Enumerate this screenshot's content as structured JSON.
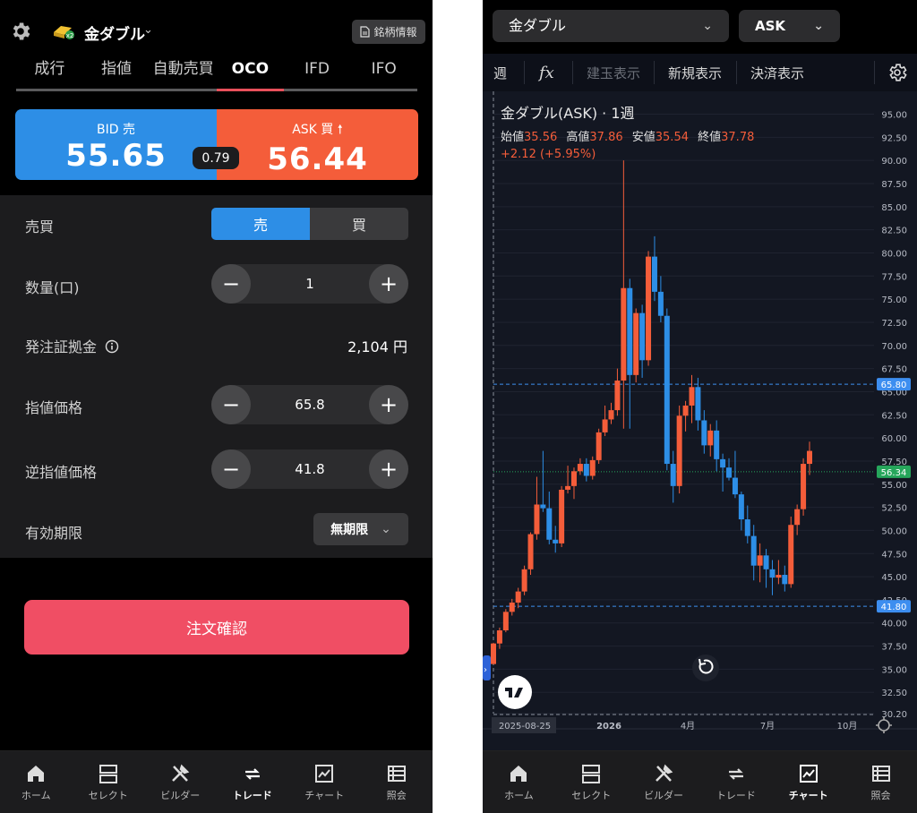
{
  "left": {
    "header": {
      "symbol": "金ダブル",
      "info_button": "銘柄情報"
    },
    "tabs": [
      "成行",
      "指値",
      "自動売買",
      "OCO",
      "IFD",
      "IFO"
    ],
    "active_tab": "OCO",
    "quote": {
      "bid_label": "BID 売",
      "bid": "55.65",
      "ask_label": "ASK 買",
      "ask": "56.44",
      "spread": "0.79"
    },
    "form": {
      "side_label": "売買",
      "sell": "売",
      "buy": "買",
      "qty_label": "数量(口)",
      "qty": "1",
      "margin_label": "発注証拠金",
      "margin": "2,104 円",
      "limit_label": "指値価格",
      "limit": "65.8",
      "stop_label": "逆指値価格",
      "stop": "41.8",
      "expiry_label": "有効期限",
      "expiry": "無期限"
    },
    "confirm": "注文確認",
    "nav": [
      "ホーム",
      "セレクト",
      "ビルダー",
      "トレード",
      "チャート",
      "照会"
    ],
    "nav_active": "トレード"
  },
  "right": {
    "symbol_select": "金ダブル",
    "side_select": "ASK",
    "toolbar": {
      "interval": "週",
      "fx": "fx",
      "pos": "建玉表示",
      "new": "新規表示",
      "settle": "決済表示"
    },
    "legend": {
      "title": "金ダブル(ASK) · 1週",
      "open_label": "始値",
      "open": "35.56",
      "high_label": "高値",
      "high": "37.86",
      "low_label": "安値",
      "low": "35.54",
      "close_label": "終値",
      "close": "37.78",
      "change": "+2.12 (+5.95%)"
    },
    "nav": [
      "ホーム",
      "セレクト",
      "ビルダー",
      "トレード",
      "チャート",
      "照会"
    ],
    "nav_active": "チャート",
    "colors": {
      "up": "#f45d3a",
      "down": "#2d8ee6",
      "line": "#3d8ef0"
    }
  },
  "chart_data": {
    "type": "candlestick",
    "y_ticks": [
      "95.00",
      "92.50",
      "90.00",
      "87.50",
      "85.00",
      "82.50",
      "80.00",
      "77.50",
      "75.00",
      "72.50",
      "70.00",
      "67.50",
      "65.00",
      "62.50",
      "60.00",
      "57.50",
      "55.00",
      "52.50",
      "50.00",
      "47.50",
      "45.00",
      "42.50",
      "40.00",
      "37.50",
      "35.00",
      "32.50",
      "30.20"
    ],
    "ylim": [
      30.2,
      96.5
    ],
    "x_labels": [
      "2025-08-25",
      "2026",
      "4月",
      "7月",
      "10月"
    ],
    "price_lines": [
      {
        "value": 65.8,
        "label": "65.80"
      },
      {
        "value": 41.8,
        "label": "41.80"
      }
    ],
    "last_price": {
      "value": 56.34,
      "label": "56.34"
    },
    "candles": [
      [
        35.56,
        37.86,
        35.54,
        37.78
      ],
      [
        37.78,
        39.5,
        37.2,
        39.2
      ],
      [
        39.2,
        41.5,
        39,
        41.2
      ],
      [
        41.2,
        42.6,
        40.8,
        42.2
      ],
      [
        42.2,
        43.8,
        41.6,
        43.4
      ],
      [
        43.4,
        46.2,
        43,
        45.8
      ],
      [
        45.8,
        49.8,
        45.2,
        49.6
      ],
      [
        49.6,
        55.8,
        49,
        52.8
      ],
      [
        52.8,
        58.6,
        52,
        52.4
      ],
      [
        52.4,
        54.2,
        48.5,
        49
      ],
      [
        49,
        50.5,
        47.6,
        48.6
      ],
      [
        48.6,
        54.8,
        48.2,
        54.4
      ],
      [
        54.4,
        57,
        54,
        54.8
      ],
      [
        54.8,
        56.8,
        53.4,
        56.4
      ],
      [
        56.4,
        57.8,
        56,
        57.2
      ],
      [
        57.2,
        57.8,
        55.3,
        55.9
      ],
      [
        55.9,
        58,
        55.5,
        57.6
      ],
      [
        57.6,
        61,
        57.2,
        60.6
      ],
      [
        60.6,
        63.5,
        60.2,
        62
      ],
      [
        62,
        63.8,
        61.5,
        63
      ],
      [
        63,
        67.5,
        62.4,
        66.2
      ],
      [
        66.2,
        90,
        61,
        76.2
      ],
      [
        76.2,
        77.2,
        61,
        66.8
      ],
      [
        66.8,
        74,
        66,
        73.5
      ],
      [
        73.5,
        74.4,
        66.5,
        68.4
      ],
      [
        68.4,
        80.2,
        67.8,
        79.6
      ],
      [
        79.6,
        81.8,
        74.8,
        75.8
      ],
      [
        75.8,
        77.5,
        72.5,
        73.2
      ],
      [
        73.2,
        74,
        56.5,
        57.2
      ],
      [
        57.2,
        58.6,
        53,
        54.8
      ],
      [
        54.8,
        63.5,
        54,
        62.4
      ],
      [
        62.4,
        64,
        60.7,
        63.5
      ],
      [
        63.5,
        66.8,
        61.6,
        65.5
      ],
      [
        65.5,
        66.5,
        60.8,
        61.9
      ],
      [
        61.9,
        63,
        58.3,
        59.2
      ],
      [
        59.2,
        61.5,
        58,
        60.8
      ],
      [
        60.8,
        61.9,
        56.4,
        57.7
      ],
      [
        57.7,
        58.3,
        54.2,
        56.8
      ],
      [
        56.8,
        57.8,
        55.4,
        55.7
      ],
      [
        55.7,
        58.6,
        53.5,
        53.9
      ],
      [
        53.9,
        54.2,
        50,
        51.2
      ],
      [
        51.2,
        52.7,
        48.6,
        49.4
      ],
      [
        49.4,
        50.6,
        44.6,
        46.2
      ],
      [
        46.2,
        48.6,
        44.4,
        47.3
      ],
      [
        47.3,
        48,
        43.8,
        45.8
      ],
      [
        45.8,
        46.8,
        43,
        44.9
      ],
      [
        44.9,
        46.8,
        44.2,
        45.2
      ],
      [
        45.2,
        46.2,
        43.4,
        44.2
      ],
      [
        44.2,
        51.5,
        43.8,
        50.6
      ],
      [
        50.6,
        52.8,
        49.5,
        52.3
      ],
      [
        52.3,
        57.8,
        51.6,
        57.2
      ],
      [
        57.2,
        59.6,
        56,
        58.6
      ]
    ]
  }
}
